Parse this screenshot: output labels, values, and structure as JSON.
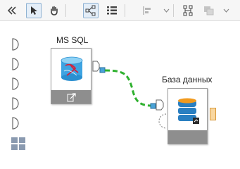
{
  "toolbar": {
    "buttons": [
      {
        "name": "collapse-panel-button",
        "icon": "double-chevron-left-icon"
      },
      {
        "name": "select-tool-button",
        "icon": "cursor-arrow-icon",
        "active": true
      },
      {
        "name": "pan-tool-button",
        "icon": "hand-icon"
      },
      {
        "name": "diagram-view-button",
        "icon": "graph-nodes-icon",
        "active": true
      },
      {
        "name": "list-view-button",
        "icon": "list-icon"
      },
      {
        "name": "align-button",
        "icon": "align-left-icon",
        "disabled": true
      },
      {
        "name": "layout-button",
        "icon": "hierarchy-icon"
      },
      {
        "name": "arrange-button",
        "icon": "overlap-squares-icon",
        "disabled": true
      }
    ]
  },
  "nodes": {
    "source": {
      "label": "MS SQL",
      "icon": "ms-sql-database-icon"
    },
    "target": {
      "label": "База данных",
      "icon": "database-stack-icon"
    }
  },
  "colors": {
    "connector": "#2fb12f",
    "node_footer": "#8e8e8e",
    "active_border": "#8fb2d2",
    "output_port": "#f5b544"
  }
}
